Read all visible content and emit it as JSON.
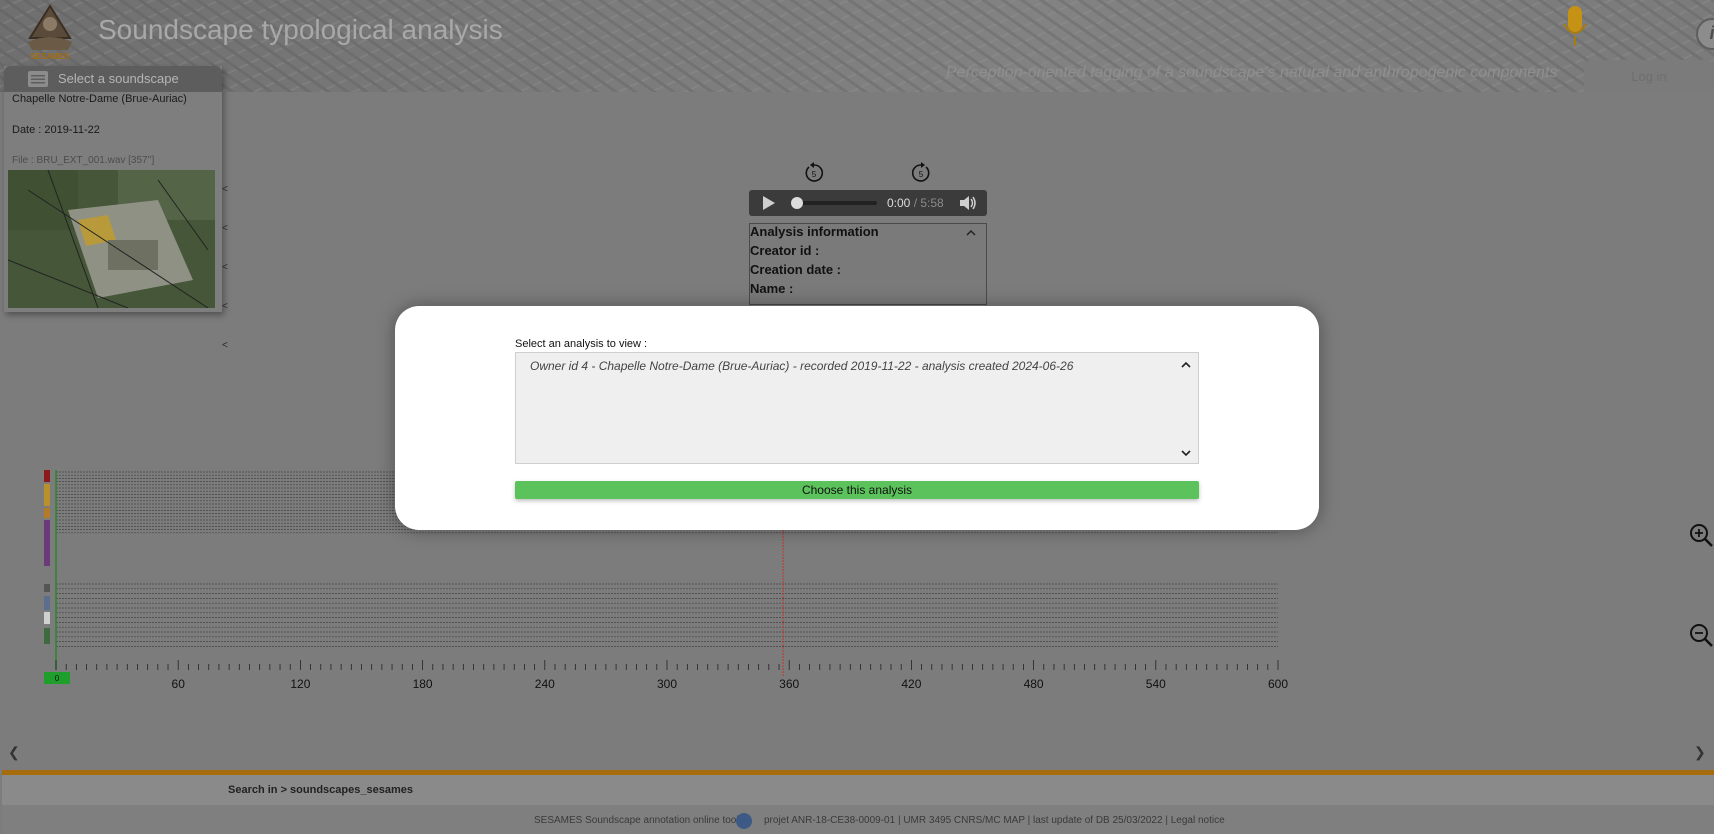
{
  "header": {
    "title": "Soundscape typological analysis",
    "tagline": "Perception-oriented tagging of a soundscape's natural and anthropogenic components",
    "login_label": "Log in",
    "logo_text": "SESAMES"
  },
  "soundscape_panel": {
    "title": "Select a soundscape",
    "name": "Chapelle Notre-Dame (Brue-Auriac)",
    "date": "Date : 2019-11-22",
    "file": "File : BRU_EXT_001.wav [357'']"
  },
  "player": {
    "current_time": "0:00",
    "separator": " / ",
    "duration": "5:58",
    "progress": 0
  },
  "analysis_info": {
    "heading": "Analysis information",
    "creator": "Creator id :",
    "creation_date": "Creation date :",
    "name": "Name :"
  },
  "timeline": {
    "ticks": [
      "60",
      "120",
      "180",
      "240",
      "300",
      "360",
      "420",
      "480",
      "540",
      "600"
    ],
    "start_marker": "0",
    "cursor_seconds": 357,
    "max_seconds": 600
  },
  "modal": {
    "label": "Select an analysis to view :",
    "options": [
      "Owner id 4 - Chapelle Notre-Dame (Brue-Auriac) - recorded 2019-11-22 - analysis created 2024-06-26"
    ],
    "button": "Choose this analysis"
  },
  "footer": {
    "search": "Search in > soundscapes_sesames",
    "left": "SESAMES Soundscape annotation online tool",
    "right": "projet ANR-18-CE38-0009-01 | UMR 3495 CNRS/MC MAP | last update of DB 25/03/2022 | Legal notice"
  },
  "colors": {
    "accent_green": "#5cc25c",
    "orange": "#a66b0b",
    "cursor_red": "#c0392b"
  }
}
